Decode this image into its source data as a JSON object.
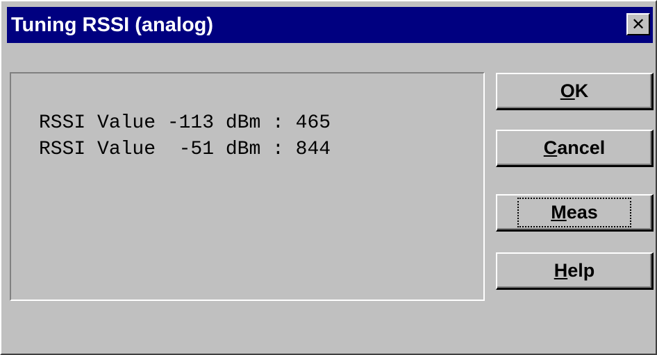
{
  "window": {
    "title": "Tuning RSSI (analog)",
    "close_glyph": "✕"
  },
  "rssi": {
    "lines": [
      "RSSI Value -113 dBm : 465",
      "RSSI Value  -51 dBm : 844"
    ]
  },
  "buttons": {
    "ok": {
      "mnemonic": "O",
      "rest": "K"
    },
    "cancel": {
      "mnemonic": "C",
      "rest": "ancel"
    },
    "meas": {
      "mnemonic": "M",
      "rest": "eas"
    },
    "help": {
      "mnemonic": "H",
      "rest": "elp"
    }
  },
  "colors": {
    "titlebar": "#000080",
    "face": "#c0c0c0"
  }
}
